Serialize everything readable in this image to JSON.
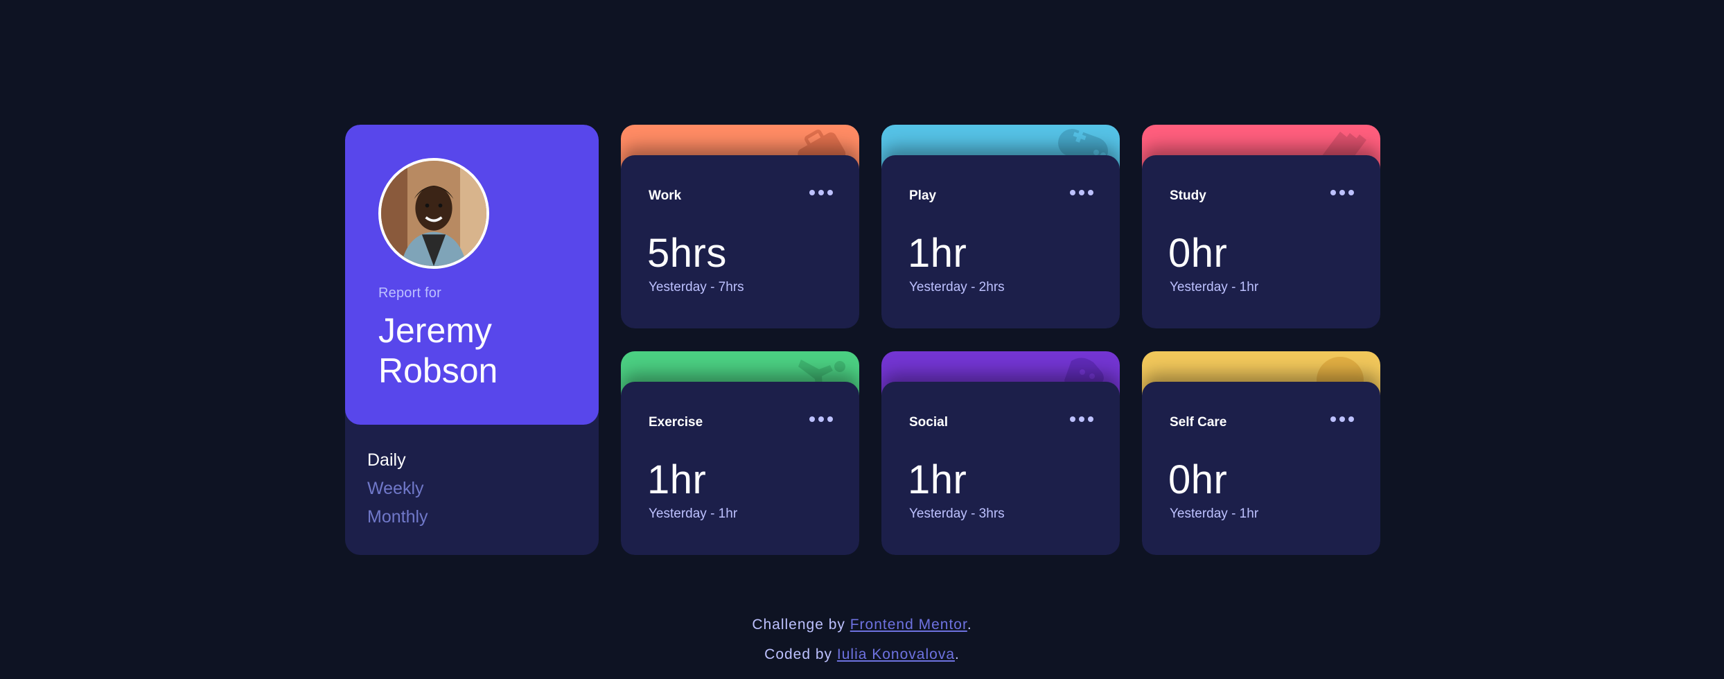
{
  "profile": {
    "report_label": "Report for",
    "first_name": "Jeremy",
    "last_name": "Robson",
    "accent_color": "#5847eb"
  },
  "periods": [
    {
      "label": "Daily",
      "active": true
    },
    {
      "label": "Weekly",
      "active": false
    },
    {
      "label": "Monthly",
      "active": false
    }
  ],
  "activities": [
    {
      "title": "Work",
      "current": "5hrs",
      "previous": "Yesterday - 7hrs",
      "color": "#ff8b64",
      "icon": "briefcase-icon"
    },
    {
      "title": "Play",
      "current": "1hr",
      "previous": "Yesterday - 2hrs",
      "color": "#55c2e6",
      "icon": "gamepad-icon"
    },
    {
      "title": "Study",
      "current": "0hr",
      "previous": "Yesterday - 1hr",
      "color": "#ff5e7d",
      "icon": "book-icon"
    },
    {
      "title": "Exercise",
      "current": "1hr",
      "previous": "Yesterday - 1hr",
      "color": "#4bcf82",
      "icon": "runner-icon"
    },
    {
      "title": "Social",
      "current": "1hr",
      "previous": "Yesterday - 3hrs",
      "color": "#7335d2",
      "icon": "social-icon"
    },
    {
      "title": "Self Care",
      "current": "0hr",
      "previous": "Yesterday - 1hr",
      "color": "#f1c75b",
      "icon": "selfcare-icon"
    }
  ],
  "footer": {
    "challenge_prefix": "Challenge by ",
    "challenge_link": "Frontend Mentor",
    "coded_prefix": "Coded by ",
    "coded_link": "Iulia Konovalova",
    "period": "."
  }
}
